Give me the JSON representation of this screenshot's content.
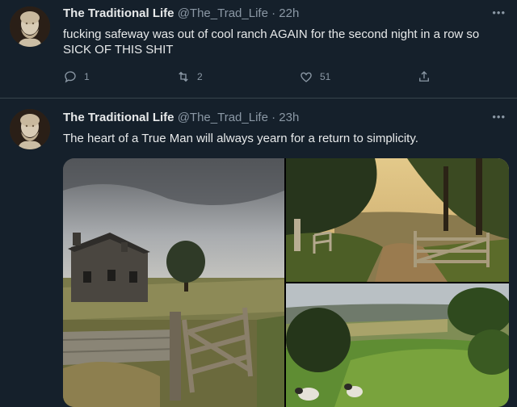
{
  "tweets": [
    {
      "name": "The Traditional Life",
      "handle": "@The_Trad_Life",
      "separator": "·",
      "time": "22h",
      "text": "fucking safeway was out of cool ranch AGAIN for the second night in a row so SICK OF THIS SHIT",
      "replies": "1",
      "retweets": "2",
      "likes": "51",
      "more": "•••"
    },
    {
      "name": "The Traditional Life",
      "handle": "@The_Trad_Life",
      "separator": "·",
      "time": "23h",
      "text": "The heart of a True Man will always yearn for a return to simplicity.",
      "more": "•••"
    }
  ],
  "icons": {
    "reply": "reply-icon",
    "retweet": "retweet-icon",
    "like": "heart-icon",
    "share": "share-icon",
    "more": "more-icon"
  },
  "colors": {
    "background": "#15202b",
    "text": "#e7e9ea",
    "secondary": "#8b98a5",
    "divider": "#38444d"
  }
}
